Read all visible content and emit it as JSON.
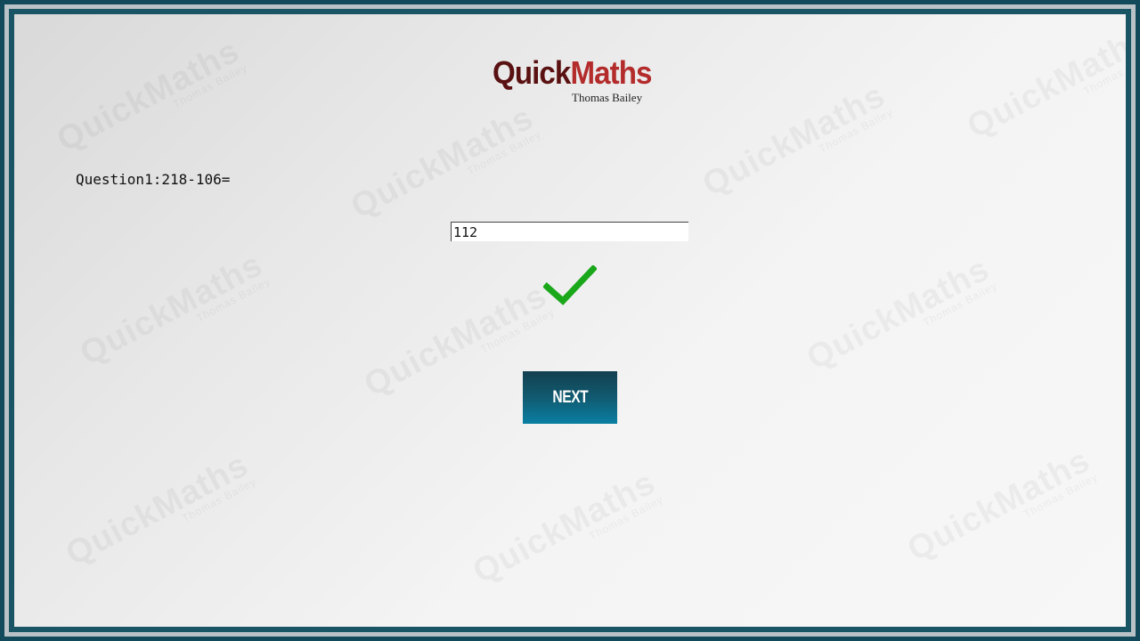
{
  "app": {
    "logo_part1": "Quick",
    "logo_part2": "Maths",
    "author": "Thomas Bailey"
  },
  "watermark": {
    "text": "QuickMaths",
    "sub": "Thomas Bailey"
  },
  "quiz": {
    "question": "Question1:218-106=",
    "answer_value": "112",
    "result": "correct",
    "result_icon": "checkmark-icon"
  },
  "actions": {
    "next_label": "NEXT"
  },
  "colors": {
    "logo_dark": "#5a1111",
    "logo_red": "#b32b2b",
    "check_green": "#1aa81a",
    "button_top": "#13404f",
    "button_bottom": "#0a7fa3",
    "frame": "#124a5b"
  }
}
